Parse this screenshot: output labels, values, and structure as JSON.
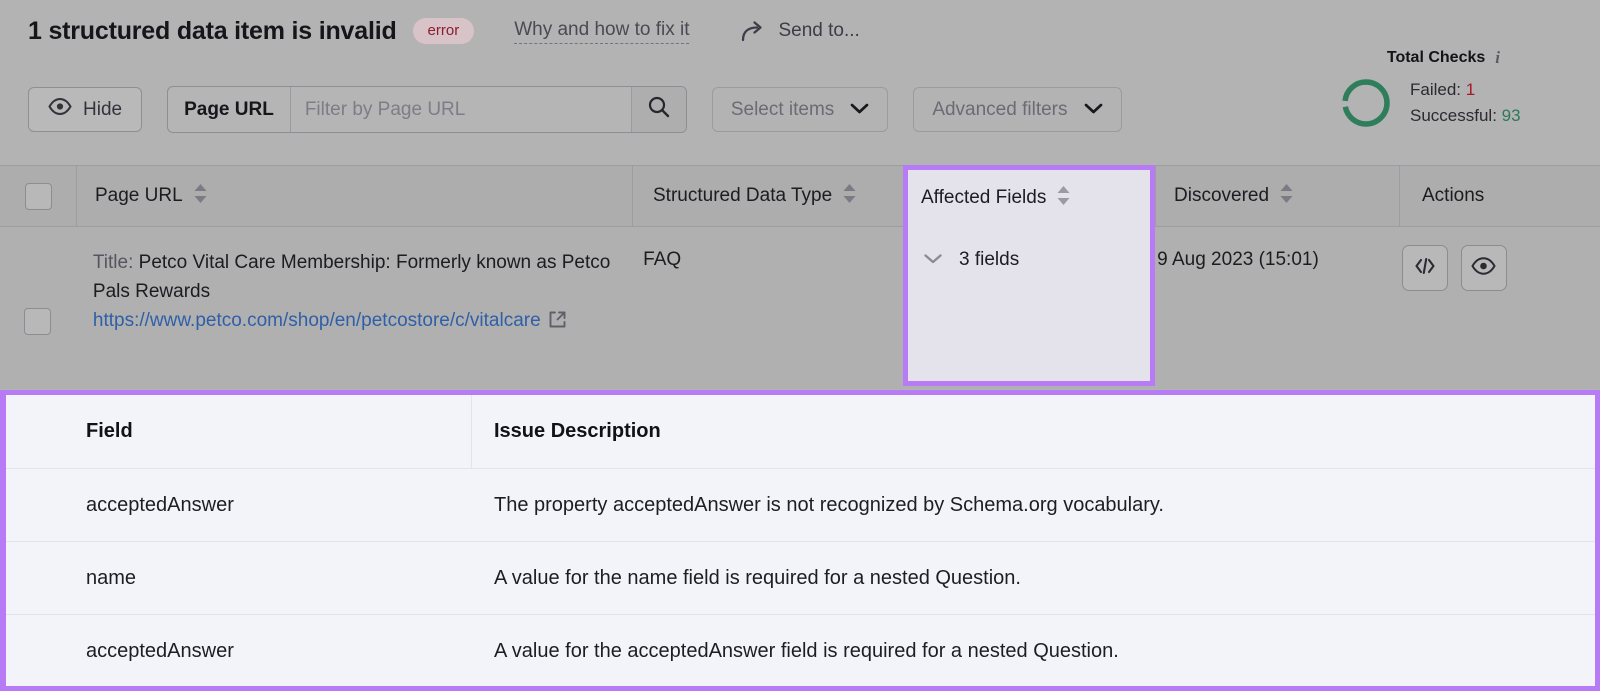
{
  "header": {
    "title": "1 structured data item is invalid",
    "badge": "error",
    "why_link": "Why and how to fix it",
    "send_to": "Send to...",
    "send_icon": "share-arrow-icon"
  },
  "total_checks": {
    "title": "Total Checks",
    "info_icon": "info-icon",
    "failed_label": "Failed:",
    "failed_value": "1",
    "successful_label": "Successful:",
    "successful_value": "93",
    "ring_color": "#2e7d5b",
    "failed_color": "#a41a28",
    "successful_color": "#2c7a5a"
  },
  "toolbar": {
    "hide_label": "Hide",
    "hide_icon": "eye-icon",
    "url_filter_label": "Page URL",
    "url_filter_placeholder": "Filter by Page URL",
    "url_filter_value": "",
    "search_icon": "search-icon",
    "select_items_label": "Select items",
    "advanced_filters_label": "Advanced filters",
    "chevron_icon": "chevron-down-icon"
  },
  "table": {
    "columns": [
      {
        "label": "Page URL",
        "sortable": true
      },
      {
        "label": "Structured Data Type",
        "sortable": true
      },
      {
        "label": "Affected Fields",
        "sortable": true
      },
      {
        "label": "Discovered",
        "sortable": true
      },
      {
        "label": "Actions",
        "sortable": false
      }
    ],
    "row": {
      "title_label": "Title:",
      "title": "Petco Vital Care Membership: Formerly known as Petco Pals Rewards",
      "url": "https://www.petco.com/shop/en/petcostore/c/vitalcare",
      "external_icon": "external-link-icon",
      "structured_data_type": "FAQ",
      "affected_fields": "3 fields",
      "affected_fields_chevron": "chevron-down-icon",
      "discovered": "9 Aug 2023 (15:01)",
      "action_code_icon": "code-icon",
      "action_view_icon": "eye-icon"
    }
  },
  "details": {
    "headers": {
      "field": "Field",
      "description": "Issue Description"
    },
    "rows": [
      {
        "field": "acceptedAnswer",
        "description": "The property acceptedAnswer is not recognized by Schema.org vocabulary."
      },
      {
        "field": "name",
        "description": "A value for the name field is required for a nested Question."
      },
      {
        "field": "acceptedAnswer",
        "description": "A value for the acceptedAnswer field is required for a nested Question."
      }
    ]
  },
  "highlight": {
    "color": "#b67bf5"
  }
}
